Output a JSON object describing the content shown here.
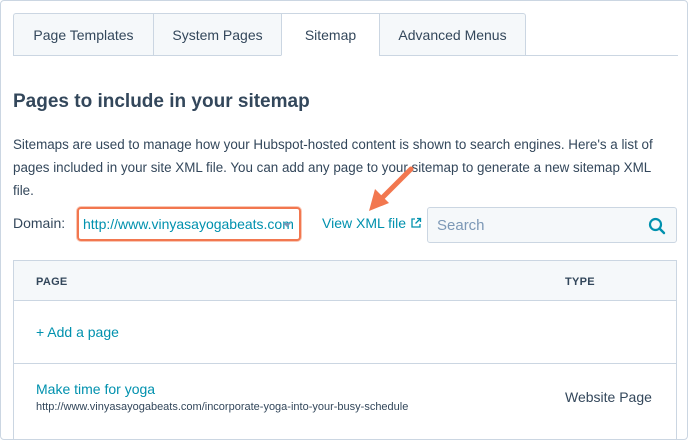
{
  "tabs": [
    {
      "label": "Page Templates"
    },
    {
      "label": "System Pages"
    },
    {
      "label": "Sitemap"
    },
    {
      "label": "Advanced Menus"
    }
  ],
  "page": {
    "title": "Pages to include in your sitemap",
    "description": "Sitemaps are used to manage how your Hubspot-hosted content is shown to search engines. Here's a list of pages included in your site XML file. You can add any page to your sitemap to generate a new sitemap XML file."
  },
  "controls": {
    "domain_label": "Domain:",
    "domain_value": "http://www.vinyasayogabeats.com",
    "view_xml_label": "View XML file",
    "search_placeholder": "Search"
  },
  "table": {
    "columns": [
      "PAGE",
      "TYPE"
    ],
    "add_label": "+ Add a page",
    "rows": [
      {
        "title": "Make time for yoga",
        "url": "http://www.vinyasayogabeats.com/incorporate-yoga-into-your-busy-schedule",
        "type": "Website Page"
      }
    ]
  },
  "colors": {
    "accent_link": "#0091ae",
    "highlight": "#f2774f",
    "text": "#33475b",
    "border": "#cbd6e2"
  },
  "icons": [
    "external-link-icon",
    "search-icon",
    "caret-down-icon",
    "annotation-arrow-icon"
  ]
}
